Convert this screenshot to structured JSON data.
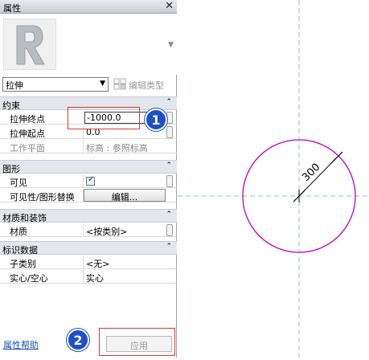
{
  "panel": {
    "title": "属性",
    "close_glyph": "✕",
    "type_selector": {
      "value": "拉伸"
    },
    "edit_type_label": "编辑类型",
    "sections": [
      {
        "name": "约束",
        "rows": [
          {
            "label": "拉伸终点",
            "value": "-1000.0",
            "editing": true
          },
          {
            "label": "拉伸起点",
            "value": "0.0"
          },
          {
            "label": "工作平面",
            "value": "标高 : 参照标高",
            "disabled": true
          }
        ]
      },
      {
        "name": "图形",
        "rows": [
          {
            "label": "可见",
            "value": "checked"
          },
          {
            "label": "可见性/图形替换",
            "value": "编辑..."
          }
        ]
      },
      {
        "name": "材质和装饰",
        "rows": [
          {
            "label": "材质",
            "value": "<按类别>"
          }
        ]
      },
      {
        "name": "标识数据",
        "rows": [
          {
            "label": "子类别",
            "value": "<无>"
          },
          {
            "label": "实心/空心",
            "value": "实心"
          }
        ]
      }
    ],
    "help_link": "属性帮助",
    "apply_button": "应用"
  },
  "callouts": {
    "one": "1",
    "two": "2"
  },
  "canvas": {
    "radius_label": "300"
  },
  "colors": {
    "circle": "#c000c0",
    "ref_line": "#8fc9a8",
    "callout": "#1c4fc9",
    "highlight": "#e53935"
  }
}
